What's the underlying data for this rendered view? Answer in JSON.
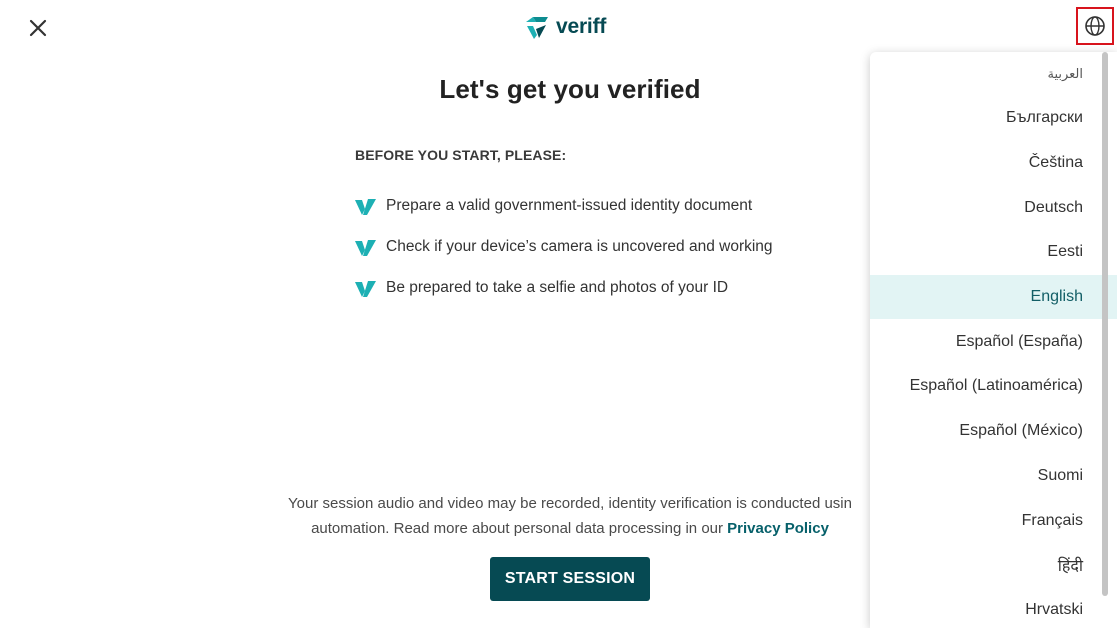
{
  "header": {
    "brand_name": "veriff",
    "close_icon": "close-icon",
    "language_icon": "globe-icon"
  },
  "main": {
    "title": "Let's get you verified",
    "before_heading": "BEFORE YOU START, PLEASE:",
    "checklist": [
      "Prepare a valid government-issued identity document",
      "Check if your device’s camera is uncovered and working",
      "Be prepared to take a selfie and photos of your ID"
    ],
    "notice_line1": "Your session audio and video may be recorded, identity verification is conducted usin",
    "notice_line2_prefix": "automation. Read more about personal data processing in our ",
    "privacy_link": "Privacy Policy",
    "start_button": "START SESSION"
  },
  "language_menu": {
    "selected": "English",
    "items": [
      "العربية",
      "Български",
      "Čeština",
      "Deutsch",
      "Eesti",
      "English",
      "Español (España)",
      "Español (Latinoamérica)",
      "Español (México)",
      "Suomi",
      "Français",
      "हिंदी",
      "Hrvatski"
    ]
  },
  "colors": {
    "brand_dark": "#064a53",
    "brand_teal": "#1db0b4",
    "selected_bg": "#e2f4f4",
    "highlight_border": "#d8141d"
  }
}
